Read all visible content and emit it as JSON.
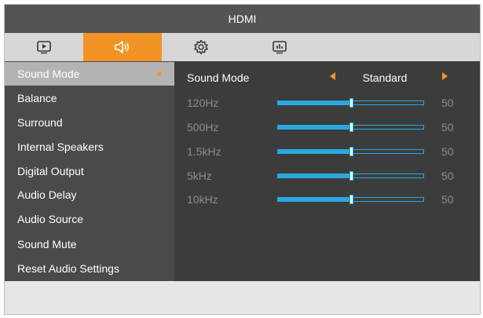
{
  "header": {
    "title": "HDMI"
  },
  "tabs": [
    {
      "icon": "picture-icon",
      "active": false
    },
    {
      "icon": "speaker-icon",
      "active": true
    },
    {
      "icon": "gear-icon",
      "active": false
    },
    {
      "icon": "display-info-icon",
      "active": false
    }
  ],
  "menu": {
    "items": [
      {
        "label": "Sound Mode",
        "selected": true
      },
      {
        "label": "Balance"
      },
      {
        "label": "Surround"
      },
      {
        "label": "Internal Speakers"
      },
      {
        "label": "Digital Output"
      },
      {
        "label": "Audio Delay"
      },
      {
        "label": "Audio Source"
      },
      {
        "label": "Sound Mute"
      },
      {
        "label": "Reset Audio Settings"
      }
    ]
  },
  "sound_mode": {
    "label": "Sound Mode",
    "value": "Standard"
  },
  "equalizer": {
    "bands": [
      {
        "label": "120Hz",
        "value": "50",
        "level_percent": 50
      },
      {
        "label": "500Hz",
        "value": "50",
        "level_percent": 50
      },
      {
        "label": "1.5kHz",
        "value": "50",
        "level_percent": 50
      },
      {
        "label": "5kHz",
        "value": "50",
        "level_percent": 50
      },
      {
        "label": "10kHz",
        "value": "50",
        "level_percent": 50
      }
    ]
  },
  "colors": {
    "accent": "#f39325",
    "slider": "#29a9e1",
    "menu_bg": "#4a4a4a",
    "panel_bg": "#3c3c3c",
    "title_bg": "#545454",
    "selected_bg": "#b3b3b3"
  }
}
